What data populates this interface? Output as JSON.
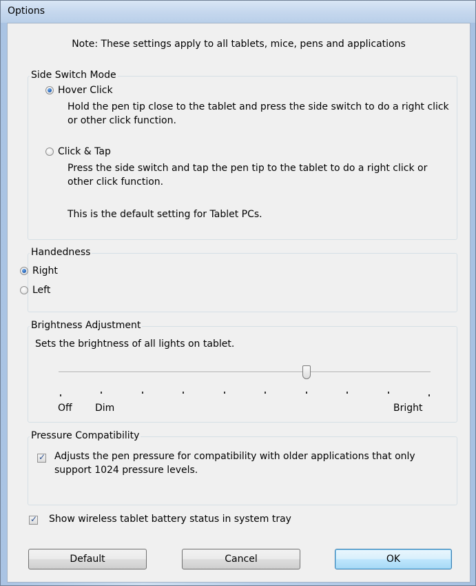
{
  "window": {
    "title": "Options"
  },
  "note": "Note: These settings apply to all tablets, mice, pens and applications",
  "side_switch": {
    "title": "Side Switch Mode",
    "options": [
      {
        "label": "Hover Click",
        "checked": true,
        "description": "Hold the pen tip close to the tablet and press the side switch to do a right click or other click function."
      },
      {
        "label": "Click & Tap",
        "checked": false,
        "description": "Press the side switch and tap the pen tip to the tablet to do a right click or other click function."
      }
    ],
    "default_note": "This is the default setting for Tablet PCs."
  },
  "handedness": {
    "title": "Handedness",
    "options": [
      {
        "label": "Right",
        "checked": true
      },
      {
        "label": "Left",
        "checked": false
      }
    ]
  },
  "brightness": {
    "title": "Brightness Adjustment",
    "description": "Sets the brightness of all lights on tablet.",
    "tick_labels": {
      "off": "Off",
      "dim": "Dim",
      "bright": "Bright"
    },
    "tick_count": 10,
    "value_index": 6
  },
  "pressure": {
    "title": "Pressure Compatibility",
    "checked": true,
    "description_line1": "Adjusts the pen pressure for compatibility with older applications that only",
    "description_line2": "support 1024 pressure levels."
  },
  "battery": {
    "checked": true,
    "label": "Show wireless tablet battery status in system tray"
  },
  "buttons": {
    "default": "Default",
    "cancel": "Cancel",
    "ok": "OK"
  }
}
